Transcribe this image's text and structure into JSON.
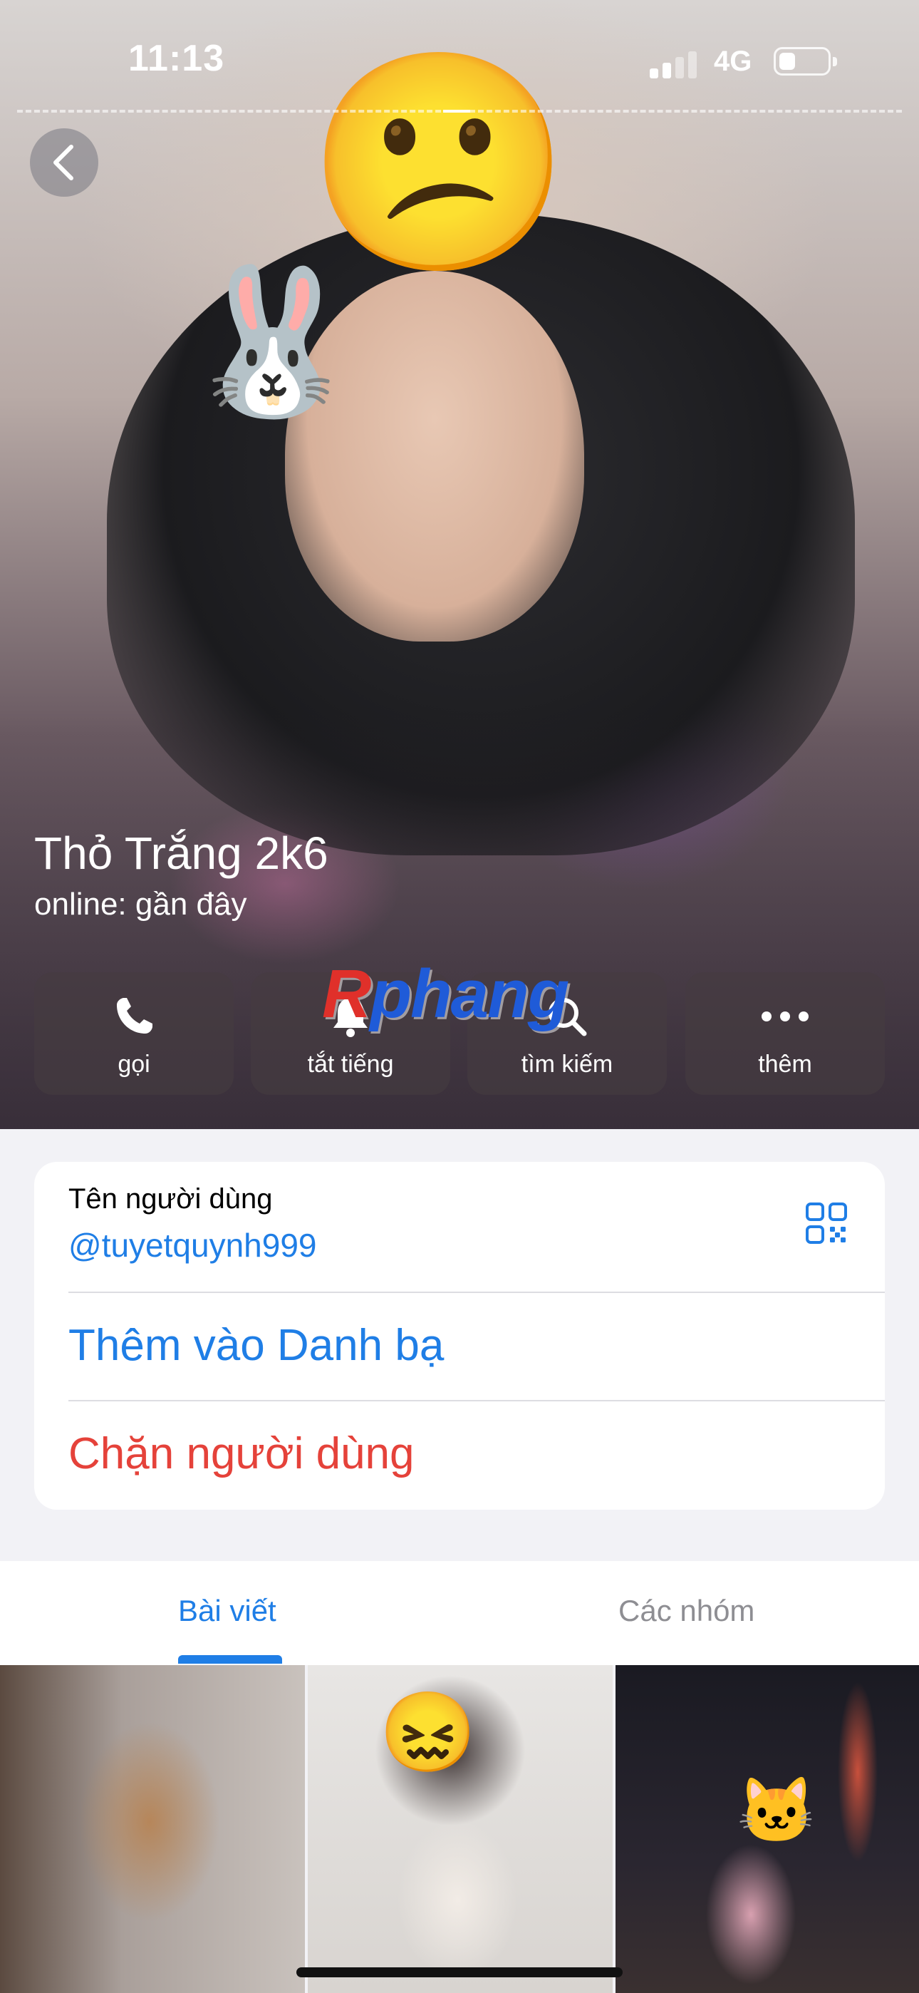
{
  "status_bar": {
    "time": "11:13",
    "network": "4G"
  },
  "profile": {
    "name": "Thỏ Trắng 2k6",
    "status": "online: gần đây"
  },
  "actions": [
    {
      "label": "gọi",
      "icon": "phone-icon"
    },
    {
      "label": "tắt tiếng",
      "icon": "bell-icon"
    },
    {
      "label": "tìm kiếm",
      "icon": "search-icon"
    },
    {
      "label": "thêm",
      "icon": "more-icon"
    }
  ],
  "watermark": {
    "first": "R",
    "rest": "phang"
  },
  "info": {
    "username_label": "Tên người dùng",
    "username": "@tuyetquynh999",
    "add_contact": "Thêm vào Danh bạ",
    "block_user": "Chặn người dùng"
  },
  "tabs": [
    {
      "label": "Bài viết",
      "active": true
    },
    {
      "label": "Các nhóm",
      "active": false
    }
  ],
  "colors": {
    "accent": "#1f7ee6",
    "danger": "#e5423a",
    "background": "#f2f2f6"
  }
}
